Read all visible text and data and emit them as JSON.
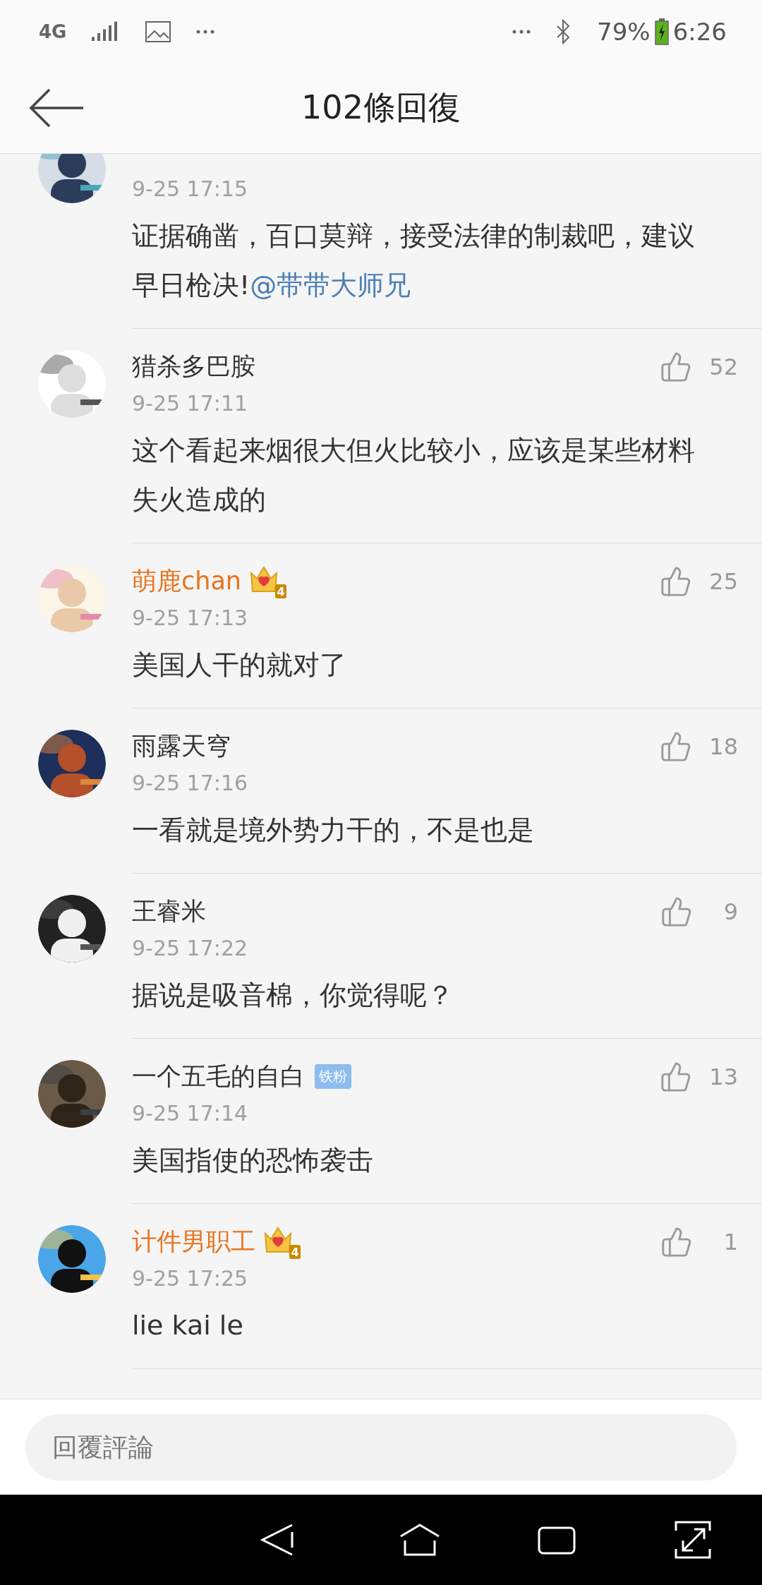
{
  "status_bar": {
    "network": "4G",
    "time": "6:26",
    "battery": "79%"
  },
  "header": {
    "title": "102條回復"
  },
  "comments": [
    {
      "time": "9-25 17:15",
      "text": "证据确凿，百口莫辩，接受法律的制裁吧，建议早日枪决!",
      "mention": "@带带大师兄"
    },
    {
      "name": "猎杀多巴胺",
      "likes": "52",
      "time": "9-25 17:11",
      "text": "这个看起来烟很大但火比较小，应该是某些材料失火造成的",
      "vip": false
    },
    {
      "name": "萌鹿chan",
      "likes": "25",
      "time": "9-25 17:13",
      "text": "美国人干的就对了",
      "vip": true,
      "badge": {
        "kind": "crown",
        "rank": "4"
      }
    },
    {
      "name": "雨露天穹",
      "likes": "18",
      "time": "9-25 17:16",
      "text": "一看就是境外势力干的，不是也是",
      "vip": false
    },
    {
      "name": "王睿米",
      "likes": "9",
      "time": "9-25 17:22",
      "text": "据说是吸音棉，你觉得呢？",
      "vip": false
    },
    {
      "name": "一个五毛的自白",
      "likes": "13",
      "time": "9-25 17:14",
      "text": "美国指使的恐怖袭击",
      "vip": false,
      "badge": {
        "kind": "label",
        "text": "铁粉"
      }
    },
    {
      "name": "计件男职工",
      "likes": "1",
      "time": "9-25 17:25",
      "text": "lie kai le",
      "vip": true,
      "badge": {
        "kind": "crown",
        "rank": "4"
      }
    }
  ],
  "reply_box": {
    "placeholder": "回覆評論"
  }
}
